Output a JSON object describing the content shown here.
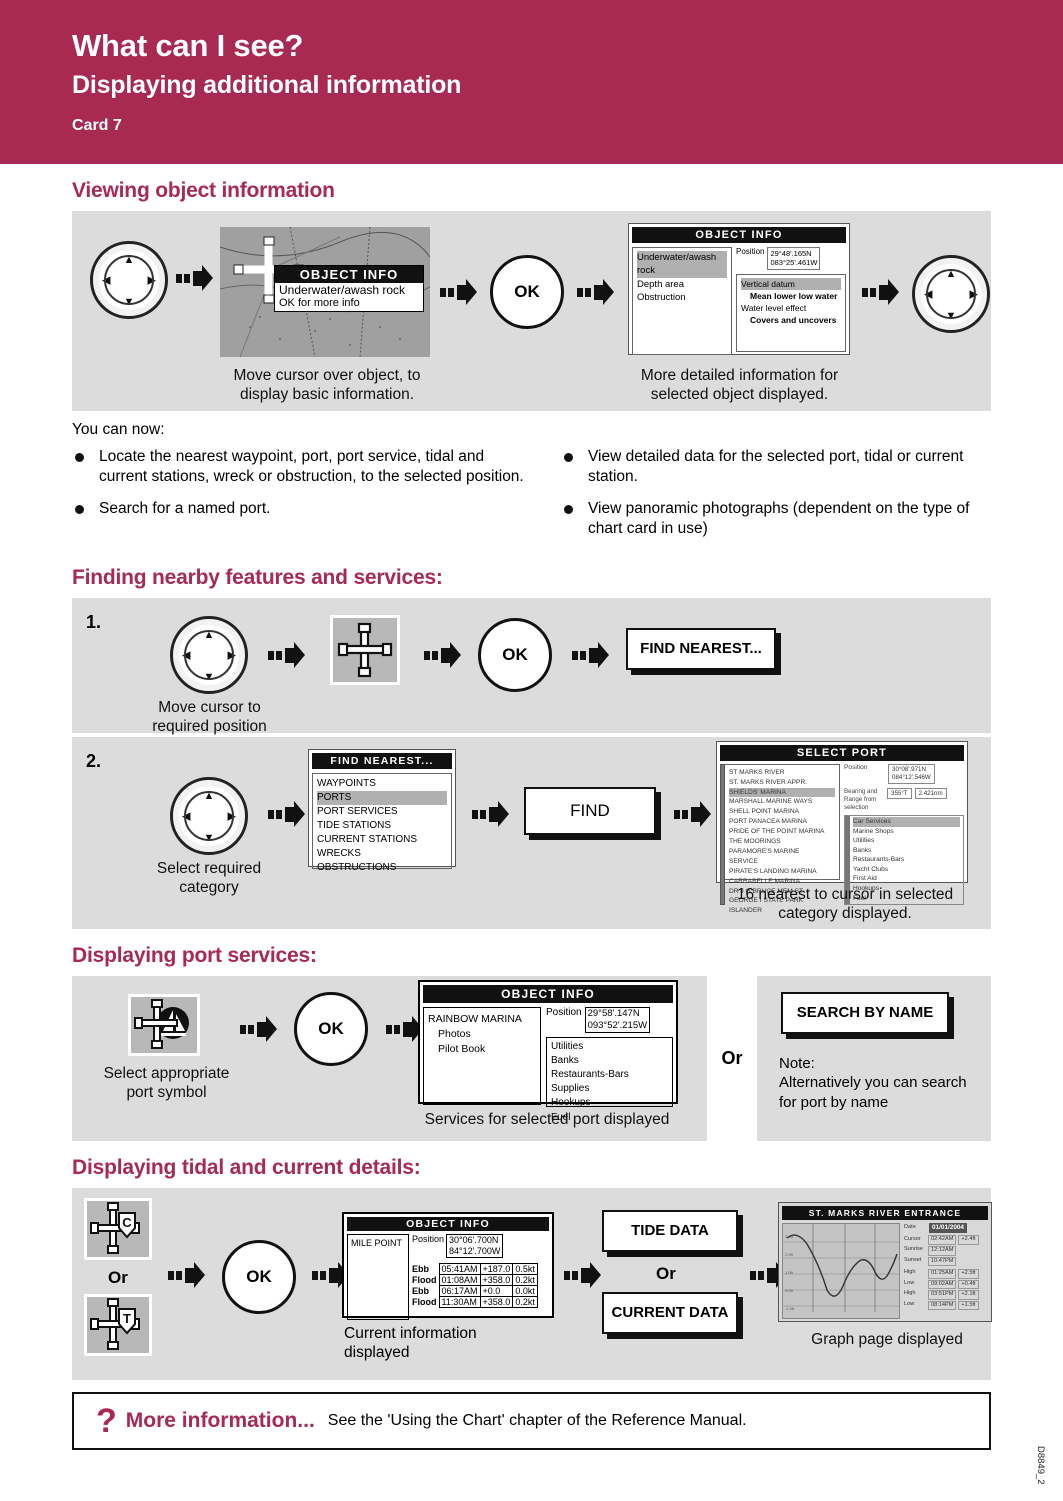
{
  "header": {
    "title": "What can I see?",
    "subtitle": "Displaying additional information",
    "card": "Card 7"
  },
  "sections": {
    "viewing": "Viewing object information",
    "finding": "Finding nearby features and services:",
    "port_services": "Displaying port services:",
    "tidal": "Displaying tidal and current details:"
  },
  "viewing": {
    "chart_popup": {
      "title": "OBJECT INFO",
      "line1": "Underwater/awash rock",
      "line2": "OK for more info"
    },
    "caption_left": [
      "Move cursor over object, to",
      "display basic information."
    ],
    "ok_label": "OK",
    "detail_screen": {
      "title": "OBJECT INFO",
      "items": [
        "Underwater/awash rock",
        "Depth area",
        "Obstruction"
      ],
      "position_label": "Position",
      "position_value": [
        "29°48'.165N",
        "083°25'.461W"
      ],
      "detail_items": [
        "Vertical datum",
        "Mean lower low water",
        "Water level effect",
        "Covers and uncovers"
      ]
    },
    "caption_right": [
      "More detailed information for",
      "selected object displayed."
    ]
  },
  "you_can_now": {
    "intro": "You can now:",
    "left": [
      "Locate the nearest waypoint, port, port service, tidal and current stations, wreck or obstruction, to the selected position.",
      "Search for a named port."
    ],
    "right": [
      "View detailed data for the selected port, tidal or current station.",
      "View panoramic photographs (dependent on the type of chart card in use)"
    ]
  },
  "finding": {
    "step1": {
      "number": "1.",
      "caption": [
        "Move cursor to",
        "required position"
      ],
      "ok_label": "OK",
      "button_label": "FIND NEAREST..."
    },
    "step2": {
      "number": "2.",
      "caption": [
        "Select required",
        "category"
      ],
      "menu_title": "FIND NEAREST...",
      "menu_items": [
        "WAYPOINTS",
        "PORTS",
        "PORT SERVICES",
        "TIDE STATIONS",
        "CURRENT STATIONS",
        "WRECKS",
        "OBSTRUCTIONS"
      ],
      "menu_selected": "PORTS",
      "find_label": "FIND",
      "select_port": {
        "title": "SELECT PORT",
        "ports": [
          "ST MARKS RIVER",
          "ST. MARKS RIVER APPR.",
          "SHIELDS' MARINA",
          "MARSHALL MARINE WAYS",
          "SHELL POINT MARINA",
          "PORT PANACEA MARINA",
          "PRIDE OF THE POINT MARINA",
          "THE MOORINGS",
          "PARAMORE'S MARINE",
          "SERVICE",
          "PIRATE'S LANDING MARINA",
          "CARRABELLE MARINA",
          "DR J G BRUCE MEM ST",
          "GEORGE I STATE PARK",
          "ISLANDER"
        ],
        "selected_port": "SHIELDS' MARINA",
        "position_label": "Position",
        "position_value": [
          "30°08'.971N",
          "084°12'.546W"
        ],
        "bearing_label": [
          "Bearing and",
          "Range from",
          "selection"
        ],
        "bearing_value": "355°T",
        "range_value": "2.421nm",
        "services": [
          "Car Services",
          "Marine Shops",
          "Utilities",
          "Banks",
          "Restaurants-Bars",
          "Yacht Clubs",
          "First Aid",
          "Hookups",
          "Fuel"
        ],
        "service_selected": "Car Services"
      },
      "caption_right": [
        "16 nearest to cursor in selected",
        "category displayed."
      ]
    }
  },
  "port_services": {
    "caption_symbol": [
      "Select appropriate",
      "port symbol"
    ],
    "ok_label": "OK",
    "screen": {
      "title": "OBJECT INFO",
      "port_name": "RAINBOW MARINA",
      "sub_items": [
        "Photos",
        "Pilot Book"
      ],
      "position_label": "Position",
      "position_value": [
        "29°58'.147N",
        "093°52'.215W"
      ],
      "services": [
        "Utilities",
        "Banks",
        "Restaurants-Bars",
        "Supplies",
        "Hookups",
        "Fuel"
      ]
    },
    "caption_services": "Services for selected port displayed",
    "or_label": "Or",
    "search_button": "SEARCH BY NAME",
    "note": [
      "Note:",
      "Alternatively you can search",
      "for port by name"
    ]
  },
  "tidal": {
    "or_label_left": "Or",
    "symbol_current": "C",
    "symbol_tide": "T",
    "ok_label": "OK",
    "screen": {
      "title": "OBJECT INFO",
      "name": "MILE POINT",
      "position_label": "Position",
      "position_value": [
        "30°06'.700N",
        "84°12'.700W"
      ],
      "rows": [
        {
          "type": "Ebb",
          "time": "05:41AM",
          "dir": "+187.0",
          "rate": "0.5kt"
        },
        {
          "type": "Flood",
          "time": "01:08AM",
          "dir": "+358.0",
          "rate": "0.2kt"
        },
        {
          "type": "Ebb",
          "time": "06:17AM",
          "dir": "+0.0",
          "rate": "0.0kt"
        },
        {
          "type": "Flood",
          "time": "11:30AM",
          "dir": "+358.0",
          "rate": "0.2kt"
        }
      ]
    },
    "caption_current": [
      "Current information",
      "displayed"
    ],
    "tide_button": "TIDE DATA",
    "or_label_mid": "Or",
    "current_button": "CURRENT DATA",
    "graph": {
      "title": "ST. MARKS RIVER ENTRANCE",
      "date_label": "Date",
      "date_value": "01/01/2004",
      "cursor_label": "Cursor",
      "cursor_time": "02:42AM",
      "cursor_height": "+2.4ft",
      "sunrise_label": "Sunrise",
      "sunrise_value": "12:12AM",
      "sunset_label": "Sunset",
      "sunset_value": "10:47PM",
      "events": [
        {
          "label": "High",
          "time": "01:25AM",
          "height": "+2.5ft"
        },
        {
          "label": "Low",
          "time": "09:02AM",
          "height": "+0.4ft"
        },
        {
          "label": "High",
          "time": "03:51PM",
          "height": "+2.1ft"
        },
        {
          "label": "Low",
          "time": "08:14PM",
          "height": "+1.5ft"
        }
      ]
    },
    "caption_graph": "Graph page displayed"
  },
  "footer": {
    "more_label": "More information...",
    "more_text": "See the 'Using the Chart' chapter of the Reference Manual.",
    "doc_id": "D8849_2"
  }
}
